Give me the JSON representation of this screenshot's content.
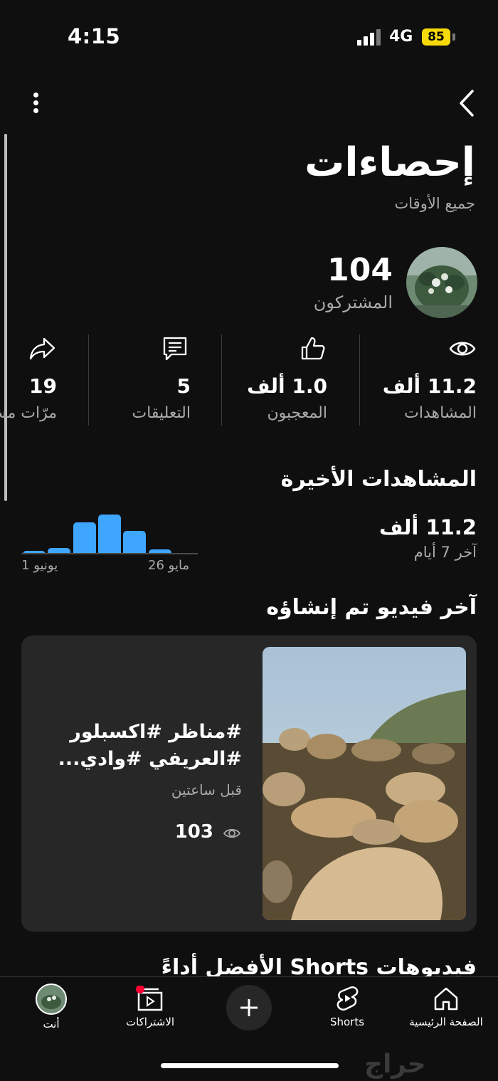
{
  "status_bar": {
    "time": "4:15",
    "network": "4G",
    "battery": "85"
  },
  "header": {
    "title": "إحصاءات",
    "subtitle": "جميع الأوقات"
  },
  "channel": {
    "subscribers": "104",
    "subscribers_label": "المشتركون"
  },
  "stats": {
    "views": {
      "value": "11.2 ألف",
      "label": "المشاهدات",
      "icon": "eye-icon"
    },
    "likes": {
      "value": "1.0 ألف",
      "label": "المعجبون",
      "icon": "thumbs-up-icon"
    },
    "comments": {
      "value": "5",
      "label": "التعليقات",
      "icon": "comment-icon"
    },
    "shares": {
      "value": "19",
      "label": "مرّات مش",
      "icon": "share-icon"
    }
  },
  "recent": {
    "title": "المشاهدات الأخيرة",
    "value": "11.2 ألف",
    "period": "آخر 7 أيام"
  },
  "chart_data": {
    "type": "bar",
    "categories": [
      "26 مايو",
      "",
      "",
      "",
      "",
      "",
      "1 يونيو"
    ],
    "values": [
      1,
      9,
      44,
      74,
      60,
      12,
      7
    ],
    "x_tick_labels": [
      "26 مايو",
      "1 يونيو"
    ],
    "colors": [
      "#4a4a4a",
      "#3ea6ff",
      "#3ea6ff",
      "#3ea6ff",
      "#3ea6ff",
      "#3ea6ff",
      "#3ea6ff"
    ]
  },
  "latest_video": {
    "section_title": "آخر فيديو تم إنشاؤه",
    "title_line1": "#مناظر #اكسبلور",
    "title_line2": "#العريفي #وادي...",
    "time": "قبل ساعتين",
    "views": "103"
  },
  "top_shorts": {
    "title": "فيديوهات Shorts الأفضل أداءً"
  },
  "bottom_nav": {
    "home": "الصفحة الرئيسية",
    "shorts": "Shorts",
    "subscriptions": "الاشتراكات",
    "you": "أنت"
  },
  "watermark": "حراج"
}
